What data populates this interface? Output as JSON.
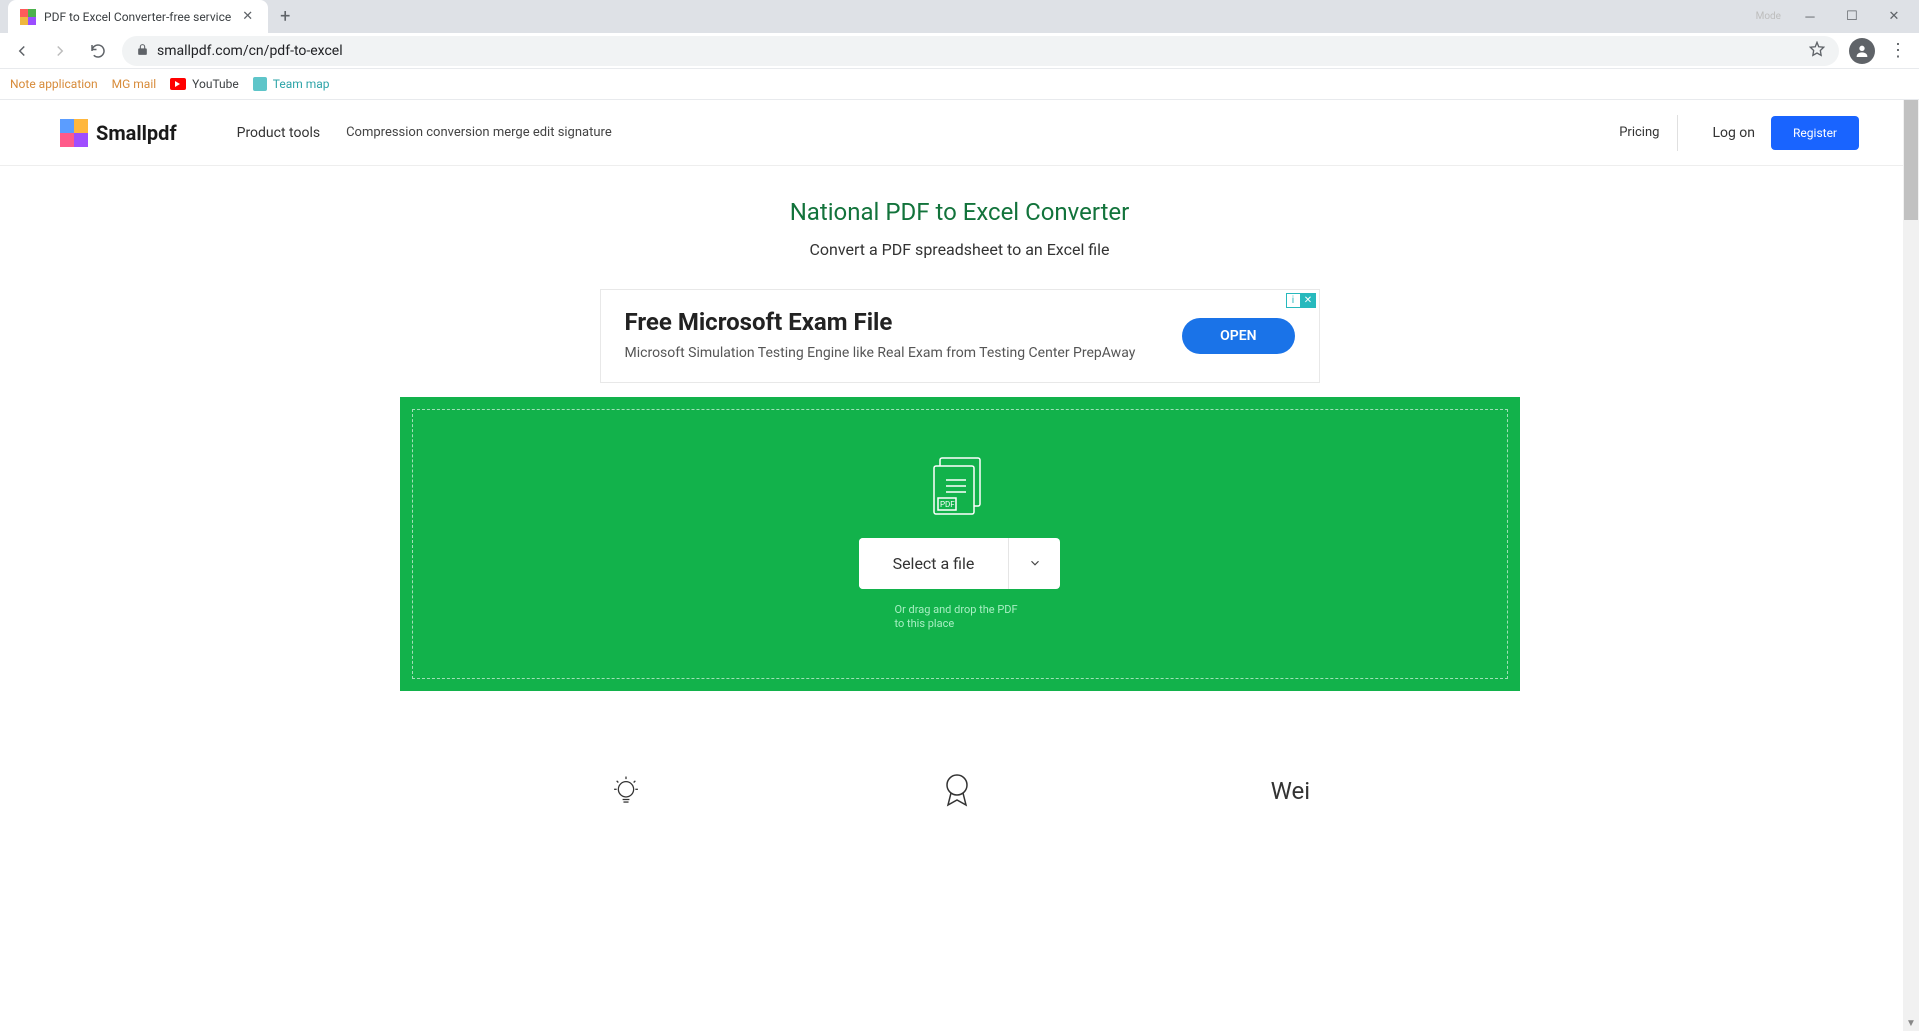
{
  "browser": {
    "tab_title": "PDF to Excel Converter-free service",
    "url": "smallpdf.com/cn/pdf-to-excel",
    "mode_label": "Mode"
  },
  "bookmarks": {
    "note": "Note application",
    "mg": "MG mail",
    "youtube": "YouTube",
    "team": "Team map"
  },
  "header": {
    "brand": "Smallpdf",
    "product_tools": "Product tools",
    "subnav": "Compression conversion merge edit signature",
    "pricing": "Pricing",
    "login": "Log on",
    "register": "Register"
  },
  "hero": {
    "title": "National PDF to Excel Converter",
    "subtitle": "Convert a PDF spreadsheet to an Excel file"
  },
  "ad": {
    "title": "Free Microsoft Exam File",
    "subtitle": "Microsoft Simulation Testing Engine like Real Exam from Testing Center PrepAway",
    "button": "OPEN",
    "info": "i",
    "close": "✕"
  },
  "dropzone": {
    "select": "Select a file",
    "hint": "Or drag and drop the PDF to this place"
  },
  "features": {
    "wei": "Wei"
  }
}
